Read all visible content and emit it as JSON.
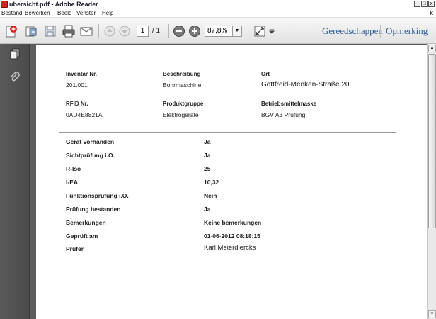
{
  "window": {
    "title": "ubersicht.pdf - Adobe Reader",
    "controls": {
      "minimize": "_",
      "maximize": "□",
      "close": "x"
    }
  },
  "menu": {
    "items": [
      "Bestand",
      "Bewerken",
      "Beeld",
      "Venster",
      "Help"
    ],
    "close": "x"
  },
  "toolbar": {
    "page_current": "1",
    "page_total": "/ 1",
    "zoom": "87,8%",
    "links": [
      "Gereedschappen",
      "Opmerking"
    ],
    "icons": [
      "create-pdf-icon",
      "open-icon",
      "save-icon",
      "print-icon",
      "email-icon",
      "previous-page-icon",
      "next-page-icon",
      "zoom-out-icon",
      "zoom-in-icon",
      "fit-page-icon",
      "more-icon"
    ]
  },
  "side_panel": {
    "icons": [
      "pages-icon",
      "attachments-icon"
    ]
  },
  "document": {
    "header_fields": [
      {
        "label": "Inventar Nr.",
        "value": "201.001"
      },
      {
        "label": "Beschreibung",
        "value": "Bohrmaschine"
      },
      {
        "label": "Ort",
        "value": "Gottfreid-Menken-Straße 20"
      },
      {
        "label": "RFID Nr.",
        "value": "0AD4E8821A"
      },
      {
        "label": "Produktgruppe",
        "value": "Elektrogeräte"
      },
      {
        "label": "Betriebsmittelmaske",
        "value": "BGV A3 Prüfung"
      }
    ],
    "results": [
      {
        "label": "Gerät vorhanden",
        "value": "Ja"
      },
      {
        "label": "Sichtprüfung i.O.",
        "value": "Ja"
      },
      {
        "label": "R-Iso",
        "value": "25"
      },
      {
        "label": "I-EA",
        "value": "10,32"
      },
      {
        "label": "Funktionsprüfung i.O.",
        "value": "Nein"
      },
      {
        "label": "Prüfung bestanden",
        "value": "Ja"
      },
      {
        "label": "Bemerkungen",
        "value": "Keine bemerkungen"
      },
      {
        "label": "Geprüft am",
        "value": "01-06-2012 08:18:15"
      },
      {
        "label": "Prüfer",
        "value": "Karl Meierdiercks"
      }
    ]
  },
  "colors": {
    "accent_link": "#2f5f96",
    "panel": "#4f4f4f",
    "app_icon": "#c8281e"
  }
}
